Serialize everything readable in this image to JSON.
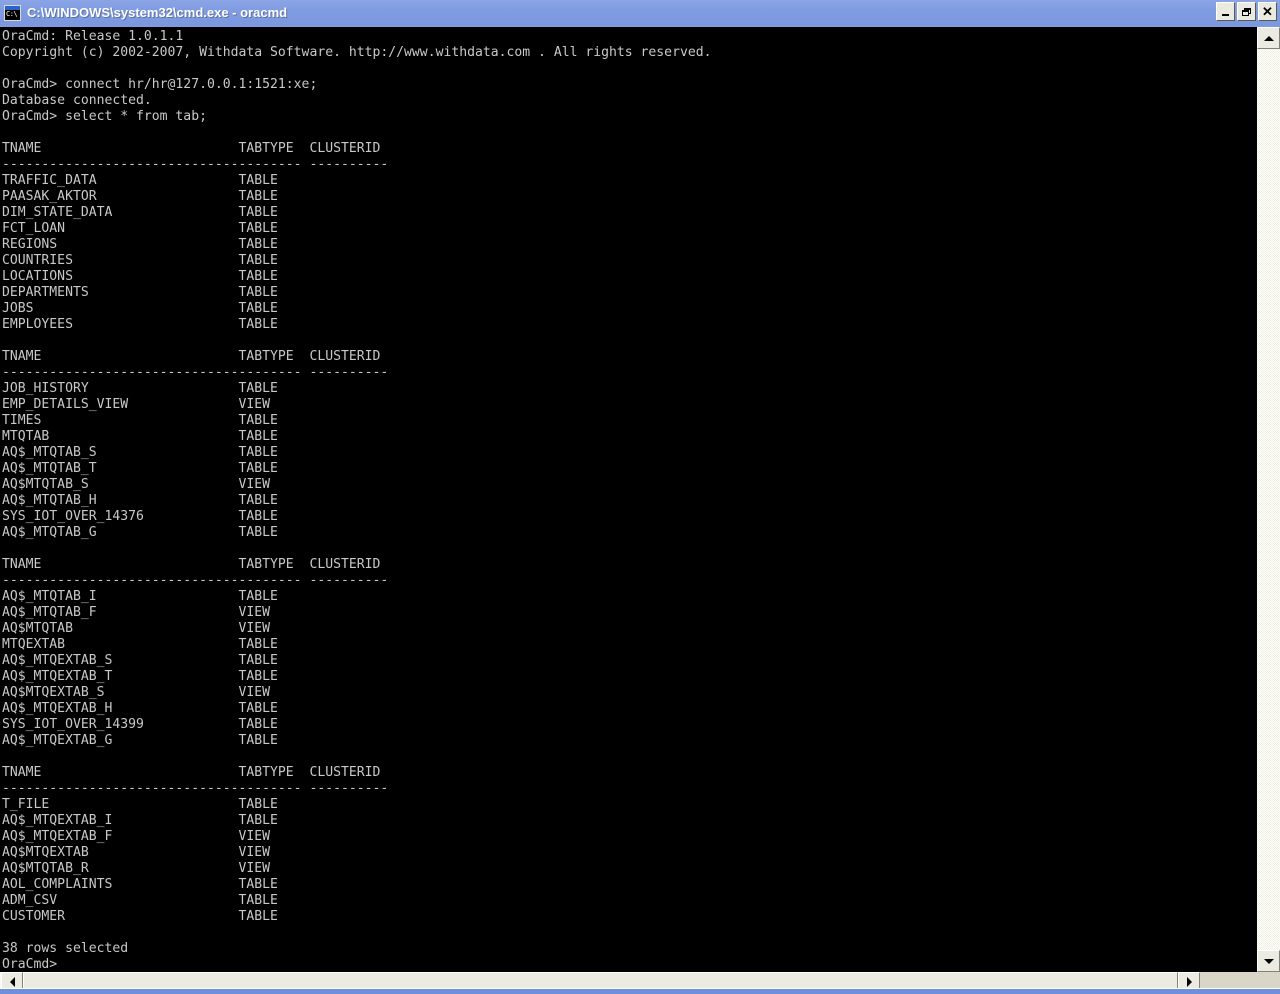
{
  "window": {
    "title": "C:\\WINDOWS\\system32\\cmd.exe - oracmd",
    "icon": "cmd-console-icon",
    "icon_text": "C:\\",
    "colors": {
      "titlebar": "#7F9BE0",
      "console_background": "#000000",
      "console_text": "#C8C8C8",
      "scrollbar_face": "#ECEBE1",
      "window_frame": "#6F8EDB"
    },
    "buttons": {
      "minimize": "Minimize",
      "restore": "Restore",
      "close": "Close"
    }
  },
  "scrollbars": {
    "vertical": {
      "up_label": "Scroll up",
      "down_label": "Scroll down"
    },
    "horizontal": {
      "left_label": "Scroll left",
      "right_label": "Scroll right",
      "thumb_label": "Horizontal scroll thumb"
    }
  },
  "console": {
    "banner": [
      "OraCmd: Release 1.0.1.1",
      "Copyright (c) 2002-2007, Withdata Software. http://www.withdata.com . All rights reserved."
    ],
    "prompt": "OraCmd>",
    "commands": [
      "connect hr/hr@127.0.0.1:1521:xe;",
      "select * from tab;"
    ],
    "messages": [
      "Database connected."
    ],
    "columns": [
      "TNAME",
      "TABTYPE",
      "CLUSTERID"
    ],
    "separators": [
      "------------------------------",
      "--------",
      "----------"
    ],
    "column_offsets": [
      0,
      30,
      39
    ],
    "blocks": [
      {
        "rows": [
          {
            "tname": "TRAFFIC_DATA",
            "tabtype": "TABLE",
            "clusterid": ""
          },
          {
            "tname": "PAASAK_AKTOR",
            "tabtype": "TABLE",
            "clusterid": ""
          },
          {
            "tname": "DIM_STATE_DATA",
            "tabtype": "TABLE",
            "clusterid": ""
          },
          {
            "tname": "FCT_LOAN",
            "tabtype": "TABLE",
            "clusterid": ""
          },
          {
            "tname": "REGIONS",
            "tabtype": "TABLE",
            "clusterid": ""
          },
          {
            "tname": "COUNTRIES",
            "tabtype": "TABLE",
            "clusterid": ""
          },
          {
            "tname": "LOCATIONS",
            "tabtype": "TABLE",
            "clusterid": ""
          },
          {
            "tname": "DEPARTMENTS",
            "tabtype": "TABLE",
            "clusterid": ""
          },
          {
            "tname": "JOBS",
            "tabtype": "TABLE",
            "clusterid": ""
          },
          {
            "tname": "EMPLOYEES",
            "tabtype": "TABLE",
            "clusterid": ""
          }
        ]
      },
      {
        "rows": [
          {
            "tname": "JOB_HISTORY",
            "tabtype": "TABLE",
            "clusterid": ""
          },
          {
            "tname": "EMP_DETAILS_VIEW",
            "tabtype": "VIEW",
            "clusterid": ""
          },
          {
            "tname": "TIMES",
            "tabtype": "TABLE",
            "clusterid": ""
          },
          {
            "tname": "MTQTAB",
            "tabtype": "TABLE",
            "clusterid": ""
          },
          {
            "tname": "AQ$_MTQTAB_S",
            "tabtype": "TABLE",
            "clusterid": ""
          },
          {
            "tname": "AQ$_MTQTAB_T",
            "tabtype": "TABLE",
            "clusterid": ""
          },
          {
            "tname": "AQ$MTQTAB_S",
            "tabtype": "VIEW",
            "clusterid": ""
          },
          {
            "tname": "AQ$_MTQTAB_H",
            "tabtype": "TABLE",
            "clusterid": ""
          },
          {
            "tname": "SYS_IOT_OVER_14376",
            "tabtype": "TABLE",
            "clusterid": ""
          },
          {
            "tname": "AQ$_MTQTAB_G",
            "tabtype": "TABLE",
            "clusterid": ""
          }
        ]
      },
      {
        "rows": [
          {
            "tname": "AQ$_MTQTAB_I",
            "tabtype": "TABLE",
            "clusterid": ""
          },
          {
            "tname": "AQ$_MTQTAB_F",
            "tabtype": "VIEW",
            "clusterid": ""
          },
          {
            "tname": "AQ$MTQTAB",
            "tabtype": "VIEW",
            "clusterid": ""
          },
          {
            "tname": "MTQEXTAB",
            "tabtype": "TABLE",
            "clusterid": ""
          },
          {
            "tname": "AQ$_MTQEXTAB_S",
            "tabtype": "TABLE",
            "clusterid": ""
          },
          {
            "tname": "AQ$_MTQEXTAB_T",
            "tabtype": "TABLE",
            "clusterid": ""
          },
          {
            "tname": "AQ$MTQEXTAB_S",
            "tabtype": "VIEW",
            "clusterid": ""
          },
          {
            "tname": "AQ$_MTQEXTAB_H",
            "tabtype": "TABLE",
            "clusterid": ""
          },
          {
            "tname": "SYS_IOT_OVER_14399",
            "tabtype": "TABLE",
            "clusterid": ""
          },
          {
            "tname": "AQ$_MTQEXTAB_G",
            "tabtype": "TABLE",
            "clusterid": ""
          }
        ]
      },
      {
        "rows": [
          {
            "tname": "T_FILE",
            "tabtype": "TABLE",
            "clusterid": ""
          },
          {
            "tname": "AQ$_MTQEXTAB_I",
            "tabtype": "TABLE",
            "clusterid": ""
          },
          {
            "tname": "AQ$_MTQEXTAB_F",
            "tabtype": "VIEW",
            "clusterid": ""
          },
          {
            "tname": "AQ$MTQEXTAB",
            "tabtype": "VIEW",
            "clusterid": ""
          },
          {
            "tname": "AQ$MTQTAB_R",
            "tabtype": "VIEW",
            "clusterid": ""
          },
          {
            "tname": "AOL_COMPLAINTS",
            "tabtype": "TABLE",
            "clusterid": ""
          },
          {
            "tname": "ADM_CSV",
            "tabtype": "TABLE",
            "clusterid": ""
          },
          {
            "tname": "CUSTOMER",
            "tabtype": "TABLE",
            "clusterid": ""
          }
        ]
      }
    ],
    "footer": "38 rows selected"
  }
}
